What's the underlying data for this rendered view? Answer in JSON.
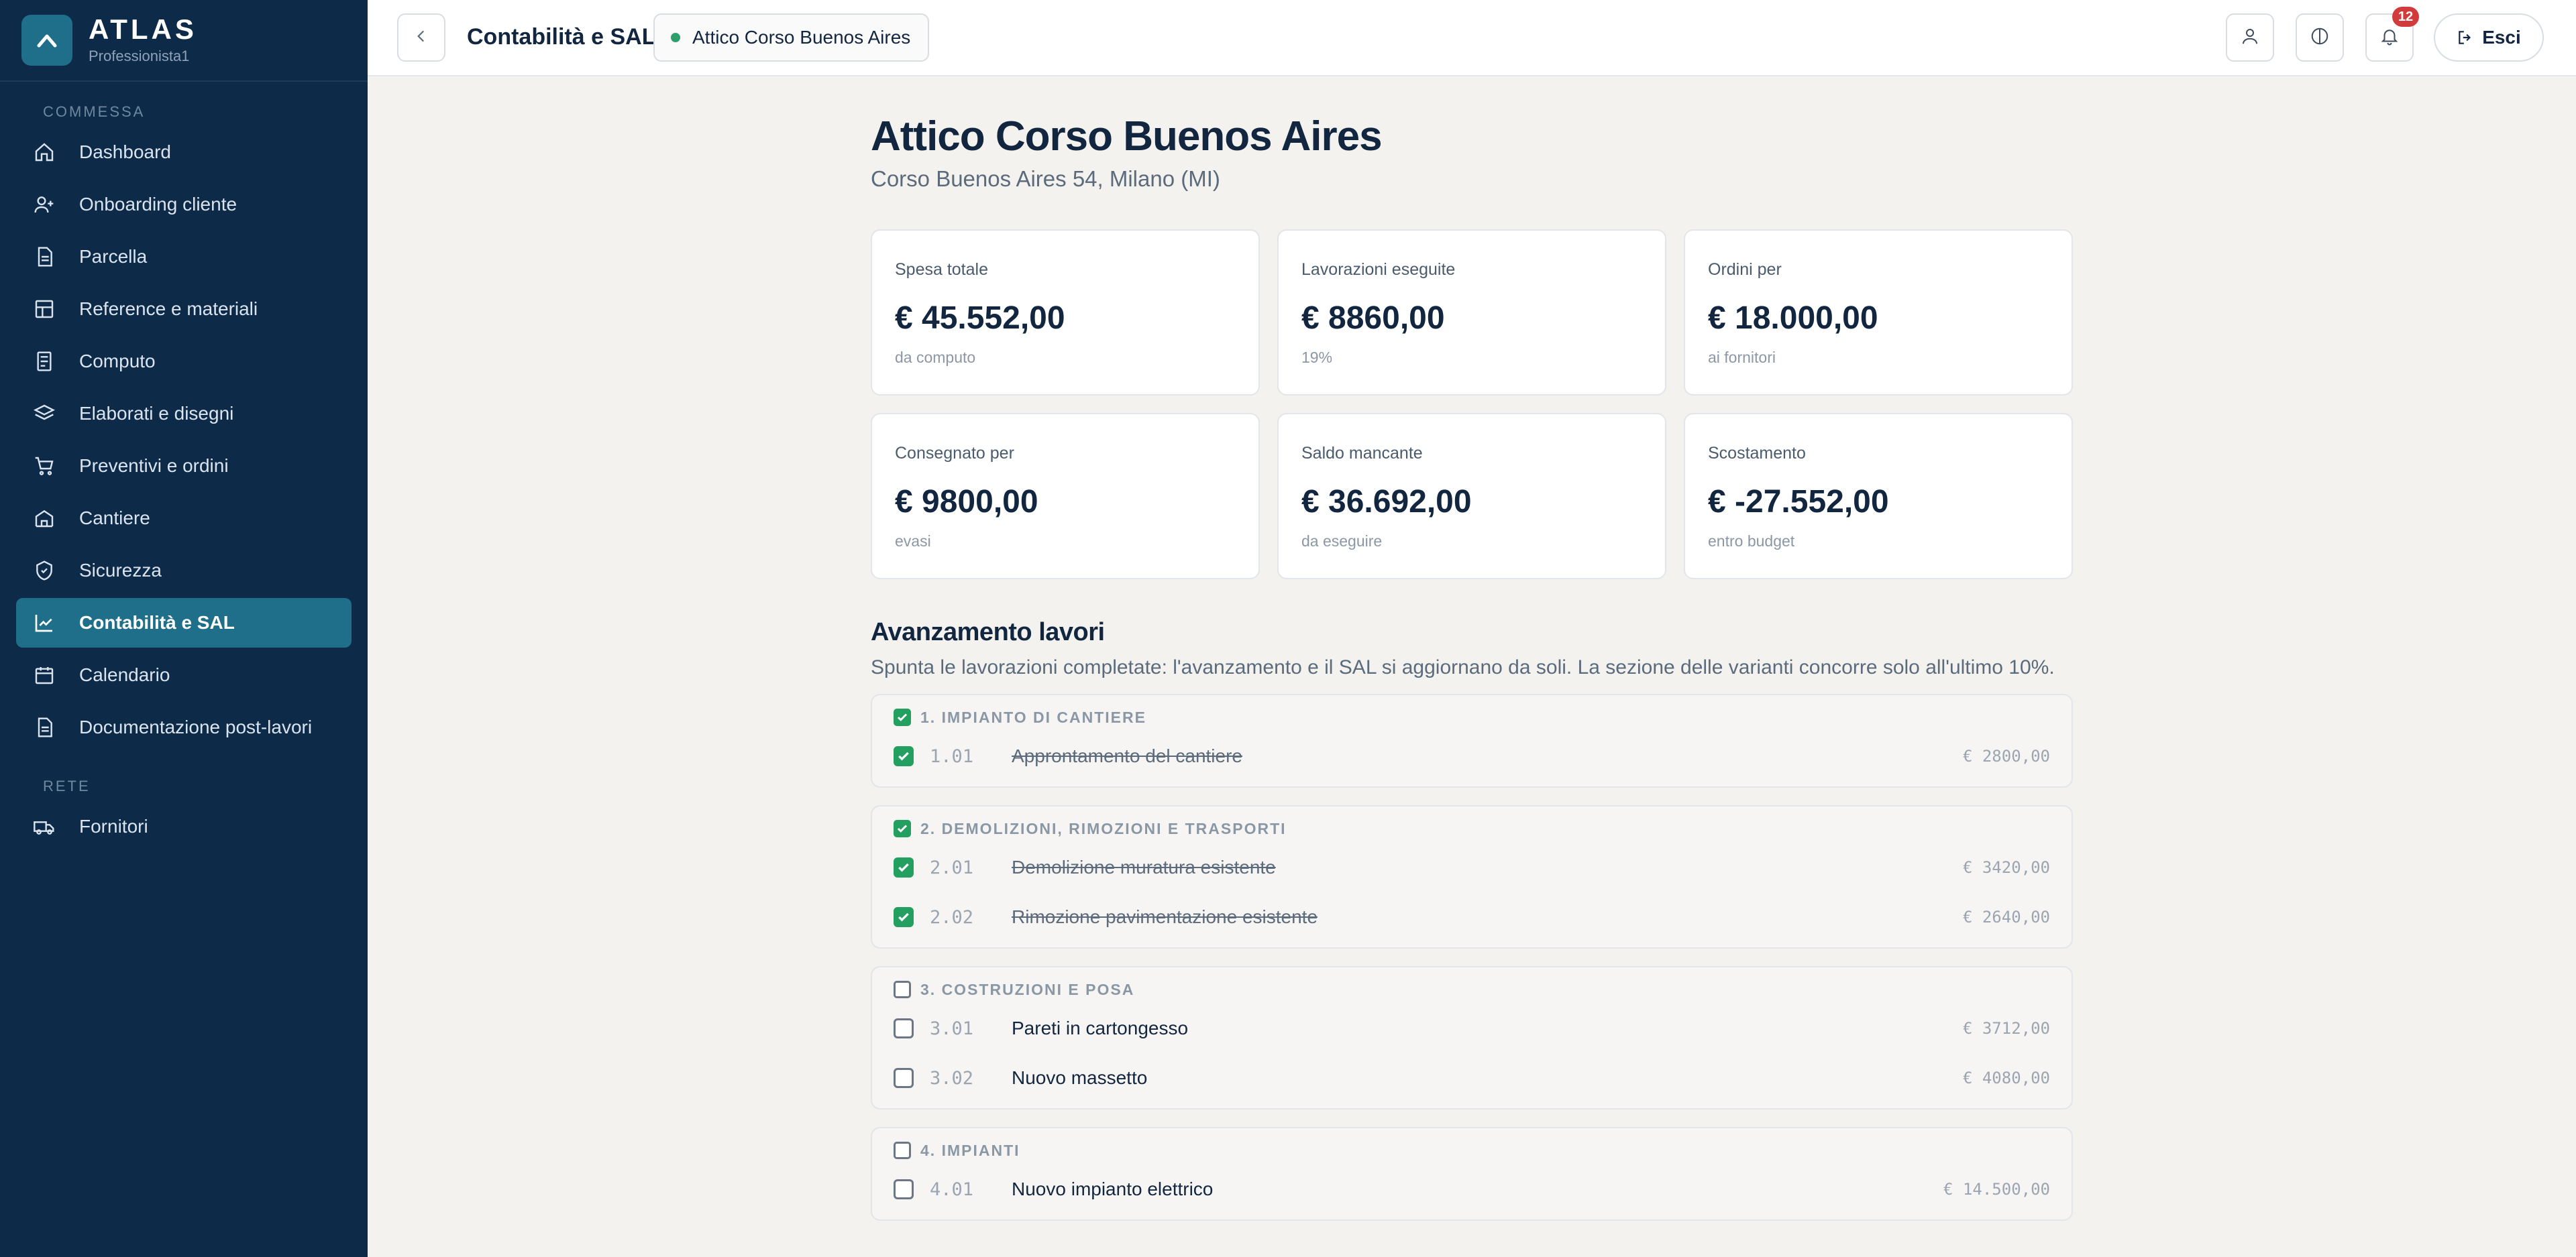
{
  "brand": {
    "name": "ATLAS",
    "user": "Professionista1"
  },
  "sidebar": {
    "section_commessa": "COMMESSA",
    "section_rete": "RETE",
    "items": [
      {
        "label": "Dashboard",
        "icon": "home-icon"
      },
      {
        "label": "Onboarding cliente",
        "icon": "user-plus-icon"
      },
      {
        "label": "Parcella",
        "icon": "document-icon"
      },
      {
        "label": "Reference e materiali",
        "icon": "grid-icon"
      },
      {
        "label": "Computo",
        "icon": "calculator-icon"
      },
      {
        "label": "Elaborati e disegni",
        "icon": "layers-icon"
      },
      {
        "label": "Preventivi e ordini",
        "icon": "cart-icon"
      },
      {
        "label": "Cantiere",
        "icon": "building-icon"
      },
      {
        "label": "Sicurezza",
        "icon": "shield-icon"
      },
      {
        "label": "Contabilità e SAL",
        "icon": "chart-icon",
        "active": true
      },
      {
        "label": "Calendario",
        "icon": "calendar-icon"
      },
      {
        "label": "Documentazione post-lavori",
        "icon": "document-icon"
      }
    ],
    "rete_items": [
      {
        "label": "Fornitori",
        "icon": "truck-icon"
      }
    ]
  },
  "topbar": {
    "title": "Contabilità e SAL",
    "project": "Attico Corso Buenos Aires",
    "notifications": "12",
    "logout": "Esci"
  },
  "main": {
    "title": "Attico Corso Buenos Aires",
    "address": "Corso Buenos Aires 54, Milano (MI)",
    "cards": [
      {
        "label": "Spesa totale",
        "value": "€ 45.552,00",
        "note": "da computo"
      },
      {
        "label": "Lavorazioni eseguite",
        "value": "€ 8860,00",
        "note": "19%"
      },
      {
        "label": "Ordini per",
        "value": "€ 18.000,00",
        "note": "ai fornitori"
      },
      {
        "label": "Consegnato per",
        "value": "€ 9800,00",
        "note": "evasi"
      },
      {
        "label": "Saldo mancante",
        "value": "€ 36.692,00",
        "note": "da eseguire"
      },
      {
        "label": "Scostamento",
        "value": "€ -27.552,00",
        "note": "entro budget"
      }
    ],
    "progress_title": "Avanzamento lavori",
    "progress_desc": "Spunta le lavorazioni completate: l'avanzamento e il SAL si aggiornano da soli. La sezione delle varianti concorre solo all'ultimo 10%.",
    "groups": [
      {
        "title": "1. IMPIANTO DI CANTIERE",
        "checked": true,
        "rows": [
          {
            "code": "1.01",
            "desc": "Approntamento del cantiere",
            "amount": "€ 2800,00",
            "done": true
          }
        ]
      },
      {
        "title": "2. DEMOLIZIONI, RIMOZIONI E TRASPORTI",
        "checked": true,
        "rows": [
          {
            "code": "2.01",
            "desc": "Demolizione muratura esistente",
            "amount": "€ 3420,00",
            "done": true
          },
          {
            "code": "2.02",
            "desc": "Rimozione pavimentazione esistente",
            "amount": "€ 2640,00",
            "done": true
          }
        ]
      },
      {
        "title": "3. COSTRUZIONI E POSA",
        "checked": false,
        "rows": [
          {
            "code": "3.01",
            "desc": "Pareti in cartongesso",
            "amount": "€ 3712,00",
            "done": false
          },
          {
            "code": "3.02",
            "desc": "Nuovo massetto",
            "amount": "€ 4080,00",
            "done": false
          }
        ]
      },
      {
        "title": "4. IMPIANTI",
        "checked": false,
        "rows": [
          {
            "code": "4.01",
            "desc": "Nuovo impianto elettrico",
            "amount": "€ 14.500,00",
            "done": false
          }
        ]
      }
    ]
  },
  "colors": {
    "sidebar_bg": "#0d2b49",
    "accent": "#1f6f8b",
    "check_green": "#23a060",
    "badge_red": "#d23b3b"
  }
}
